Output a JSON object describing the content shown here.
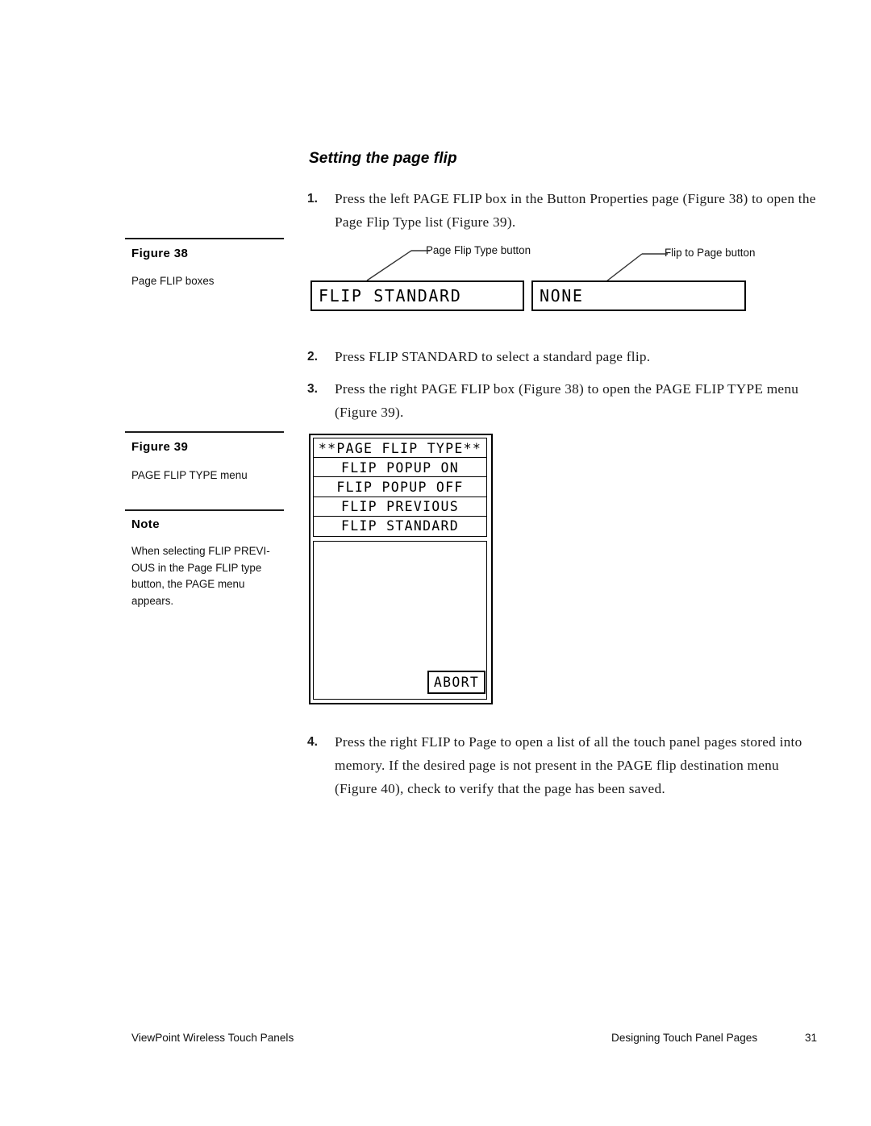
{
  "section": {
    "heading": "Setting the page flip"
  },
  "steps": [
    {
      "number": "1.",
      "text": "Press the left PAGE FLIP box in the Button Properties page (Figure 38) to open the Page Flip Type list (Figure 39)."
    },
    {
      "number": "2.",
      "text": "Press FLIP STANDARD to select a standard page flip."
    },
    {
      "number": "3.",
      "text": "Press the right PAGE FLIP box (Figure 38) to open the PAGE FLIP TYPE menu (Figure 39)."
    },
    {
      "number": "4.",
      "text": "Press the right FLIP to Page to open a list of all the touch panel pages stored into memory. If the desired page is not present in the PAGE flip destination menu (Figure 40), check to verify that the page has been saved."
    }
  ],
  "margin": {
    "figure38": {
      "title": "Figure 38",
      "caption": "Page FLIP boxes"
    },
    "figure39": {
      "title": "Figure 39",
      "caption": "PAGE FLIP TYPE menu"
    },
    "note": {
      "title": "Note",
      "body": "When selecting FLIP PREVI-OUS in the Page FLIP type button, the PAGE menu appears."
    }
  },
  "figure38": {
    "left_box_value": "FLIP STANDARD",
    "right_box_value": "NONE",
    "left_callout": "Page Flip Type button",
    "right_callout": "Flip to Page button"
  },
  "figure39": {
    "menu_items": [
      "**PAGE FLIP TYPE**",
      "FLIP POPUP ON",
      "FLIP POPUP OFF",
      "FLIP PREVIOUS",
      "FLIP STANDARD"
    ],
    "abort_label": "ABORT"
  },
  "footer": {
    "left": "ViewPoint Wireless Touch Panels",
    "right": "Designing Touch Panel Pages",
    "page_number": "31"
  }
}
